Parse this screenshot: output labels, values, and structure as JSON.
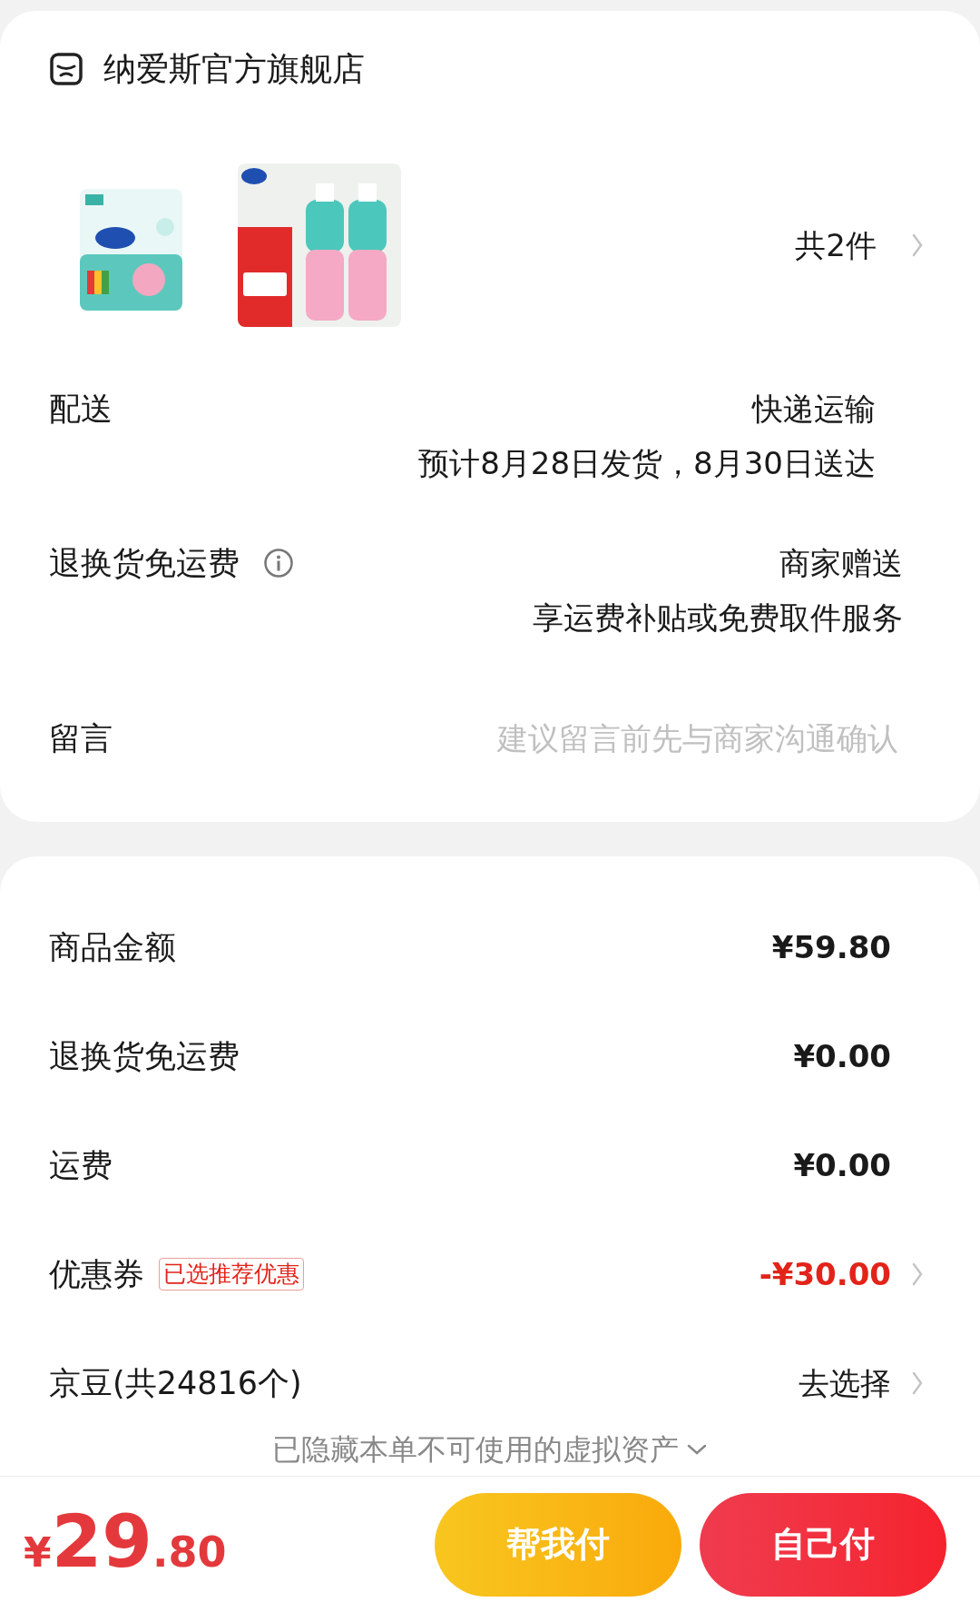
{
  "store": {
    "name": "纳爱斯官方旗舰店"
  },
  "item_count": "共2件",
  "details": [
    {
      "label": "配送",
      "lines": [
        "快递运输",
        "预计8月28日发货，8月30日送达"
      ],
      "info": false
    },
    {
      "label": "退换货免运费",
      "lines": [
        "商家赠送",
        "享运费补贴或免费取件服务"
      ],
      "info": true
    }
  ],
  "message": {
    "label": "留言",
    "placeholder": "建议留言前先与商家沟通确认"
  },
  "summary": [
    {
      "label": "商品金额",
      "value": "¥59.80",
      "kind": "amount",
      "chevron": false
    },
    {
      "label": "退换货免运费",
      "value": "¥0.00",
      "kind": "amount",
      "chevron": false
    },
    {
      "label": "运费",
      "value": "¥0.00",
      "kind": "amount",
      "chevron": false
    },
    {
      "label": "优惠券",
      "badge": "已选推荐优惠",
      "value": "-¥30.00",
      "kind": "discount",
      "chevron": true
    },
    {
      "label": "京豆(共24816个)",
      "value": "去选择",
      "kind": "action",
      "chevron": true
    }
  ],
  "hidden_note": "已隐藏本单不可使用的虚拟资产",
  "total": {
    "currency": "¥",
    "integer": "29",
    "decimal": ".80"
  },
  "buttons": [
    {
      "label": "帮我付",
      "kind": "secondary"
    },
    {
      "label": "自己付",
      "kind": "primary"
    }
  ]
}
